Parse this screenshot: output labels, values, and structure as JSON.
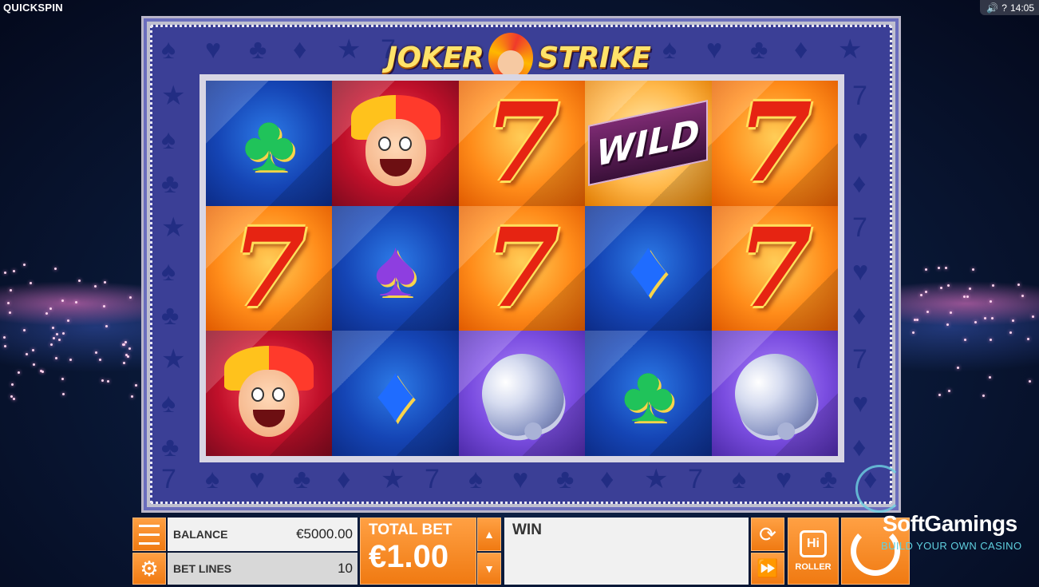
{
  "topbar": {
    "brand": "QUICKSPIN",
    "help_icon": "?",
    "time": "14:05"
  },
  "game": {
    "logo_left": "JOKER",
    "logo_right": "STRIKE",
    "wild_label": "WILD",
    "grid": [
      [
        {
          "symbol": "club",
          "bg": "blue"
        },
        {
          "symbol": "joker",
          "bg": "red"
        },
        {
          "symbol": "seven",
          "bg": "orange"
        },
        {
          "symbol": "wild",
          "bg": "gold"
        },
        {
          "symbol": "seven",
          "bg": "orange"
        }
      ],
      [
        {
          "symbol": "seven",
          "bg": "orange"
        },
        {
          "symbol": "spade",
          "bg": "blue"
        },
        {
          "symbol": "seven",
          "bg": "orange"
        },
        {
          "symbol": "diamond",
          "bg": "blue"
        },
        {
          "symbol": "seven",
          "bg": "orange"
        }
      ],
      [
        {
          "symbol": "joker",
          "bg": "red"
        },
        {
          "symbol": "diamond",
          "bg": "blue"
        },
        {
          "symbol": "bell",
          "bg": "purple"
        },
        {
          "symbol": "club",
          "bg": "blue"
        },
        {
          "symbol": "bell",
          "bg": "purple"
        }
      ]
    ]
  },
  "controls": {
    "balance_label": "BALANCE",
    "balance_value": "€5000.00",
    "betlines_label": "BET LINES",
    "betlines_value": "10",
    "total_bet_label": "TOTAL BET",
    "total_bet_value": "€1.00",
    "win_label": "WIN",
    "roller_label": "ROLLER",
    "hi_label": "Hi"
  },
  "watermark": {
    "title": "SoftGamings",
    "subtitle": "BUILD YOUR OWN CASINO"
  },
  "colors": {
    "accent_orange": "#f7891f",
    "frame_blue": "#3b3f96"
  }
}
